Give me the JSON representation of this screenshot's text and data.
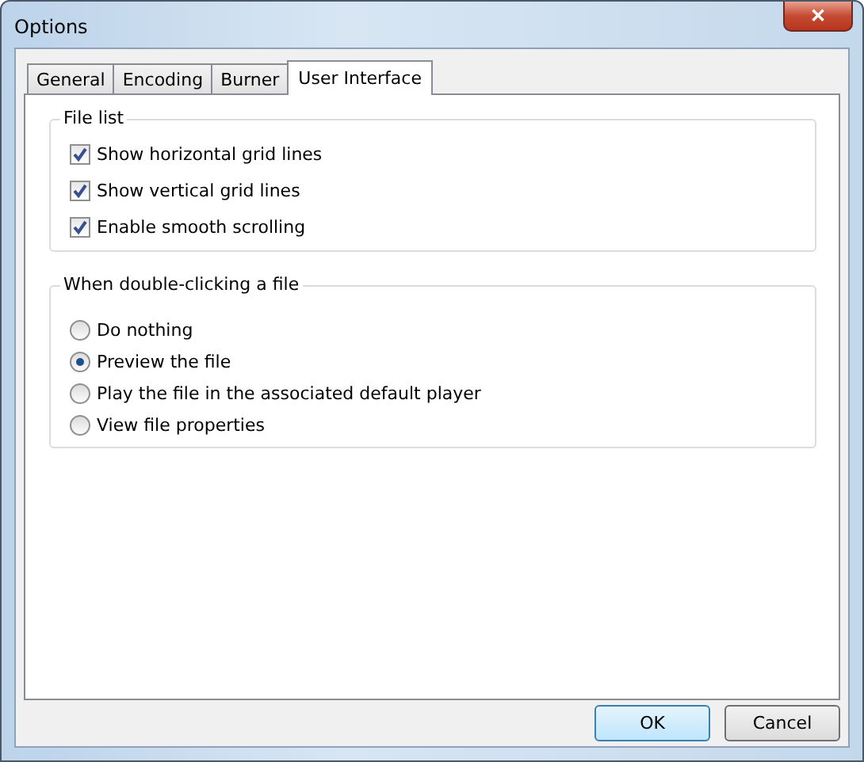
{
  "window": {
    "title": "Options",
    "close": "✕"
  },
  "tabs": [
    {
      "label": "General",
      "selected": false
    },
    {
      "label": "Encoding",
      "selected": false
    },
    {
      "label": "Burner",
      "selected": false
    },
    {
      "label": "User Interface",
      "selected": true
    }
  ],
  "groups": [
    {
      "title": "File list",
      "items": [
        {
          "kind": "checkbox",
          "label": "Show horizontal grid lines",
          "checked": true
        },
        {
          "kind": "checkbox",
          "label": "Show vertical grid lines",
          "checked": true
        },
        {
          "kind": "checkbox",
          "label": "Enable smooth scrolling",
          "checked": true
        }
      ]
    },
    {
      "title": "When double-clicking a file",
      "items": [
        {
          "kind": "radio",
          "label": "Do nothing",
          "selected": false
        },
        {
          "kind": "radio",
          "label": "Preview the file",
          "selected": true
        },
        {
          "kind": "radio",
          "label": "Play the file in the associated default player",
          "selected": false
        },
        {
          "kind": "radio",
          "label": "View file properties",
          "selected": false
        }
      ]
    }
  ],
  "buttons": [
    {
      "label": "OK",
      "default": true
    },
    {
      "label": "Cancel",
      "default": false
    }
  ]
}
